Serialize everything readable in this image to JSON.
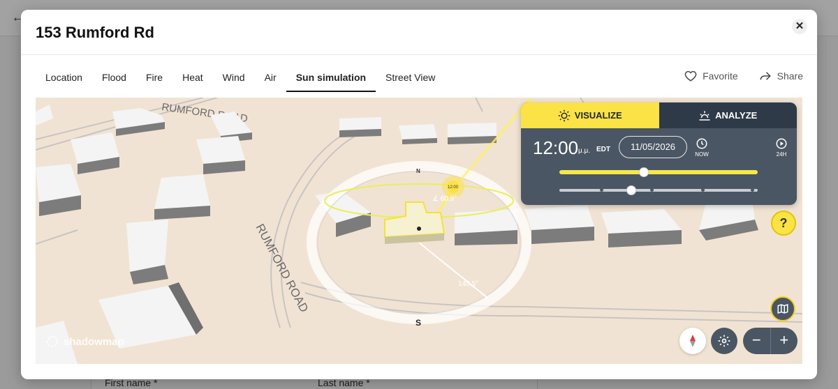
{
  "modal": {
    "title": "153 Rumford Rd",
    "close_label": "✕"
  },
  "tabs": [
    {
      "label": "Location"
    },
    {
      "label": "Flood"
    },
    {
      "label": "Fire"
    },
    {
      "label": "Heat"
    },
    {
      "label": "Wind"
    },
    {
      "label": "Air"
    },
    {
      "label": "Sun simulation",
      "active": true
    },
    {
      "label": "Street View"
    }
  ],
  "actions": {
    "favorite": "Favorite",
    "share": "Share"
  },
  "map": {
    "road_top": "RUMFORD ROAD",
    "road_left": "RUMFORD ROAD",
    "compass_n": "N",
    "compass_s": "S",
    "sun_time": "12:00",
    "sun_elevation": "∡ 60,9°",
    "azimuth": "145,5°",
    "brand": "shadowmap"
  },
  "sun_panel": {
    "visualize_label": "VISUALIZE",
    "analyze_label": "ANALYZE",
    "time": "12:00",
    "ampm": "μ.μ.",
    "timezone": "EDT",
    "date": "11/05/2026",
    "now_label": "NOW",
    "play_label": "24H"
  },
  "help_label": "?",
  "zoom": {
    "out_label": "−",
    "in_label": "+"
  },
  "background": {
    "first_name_label": "First name *",
    "last_name_label": "Last name *"
  },
  "colors": {
    "accent_yellow": "#fbe245",
    "panel_dark": "#4a5663",
    "map_ground": "#f1e3d3"
  }
}
